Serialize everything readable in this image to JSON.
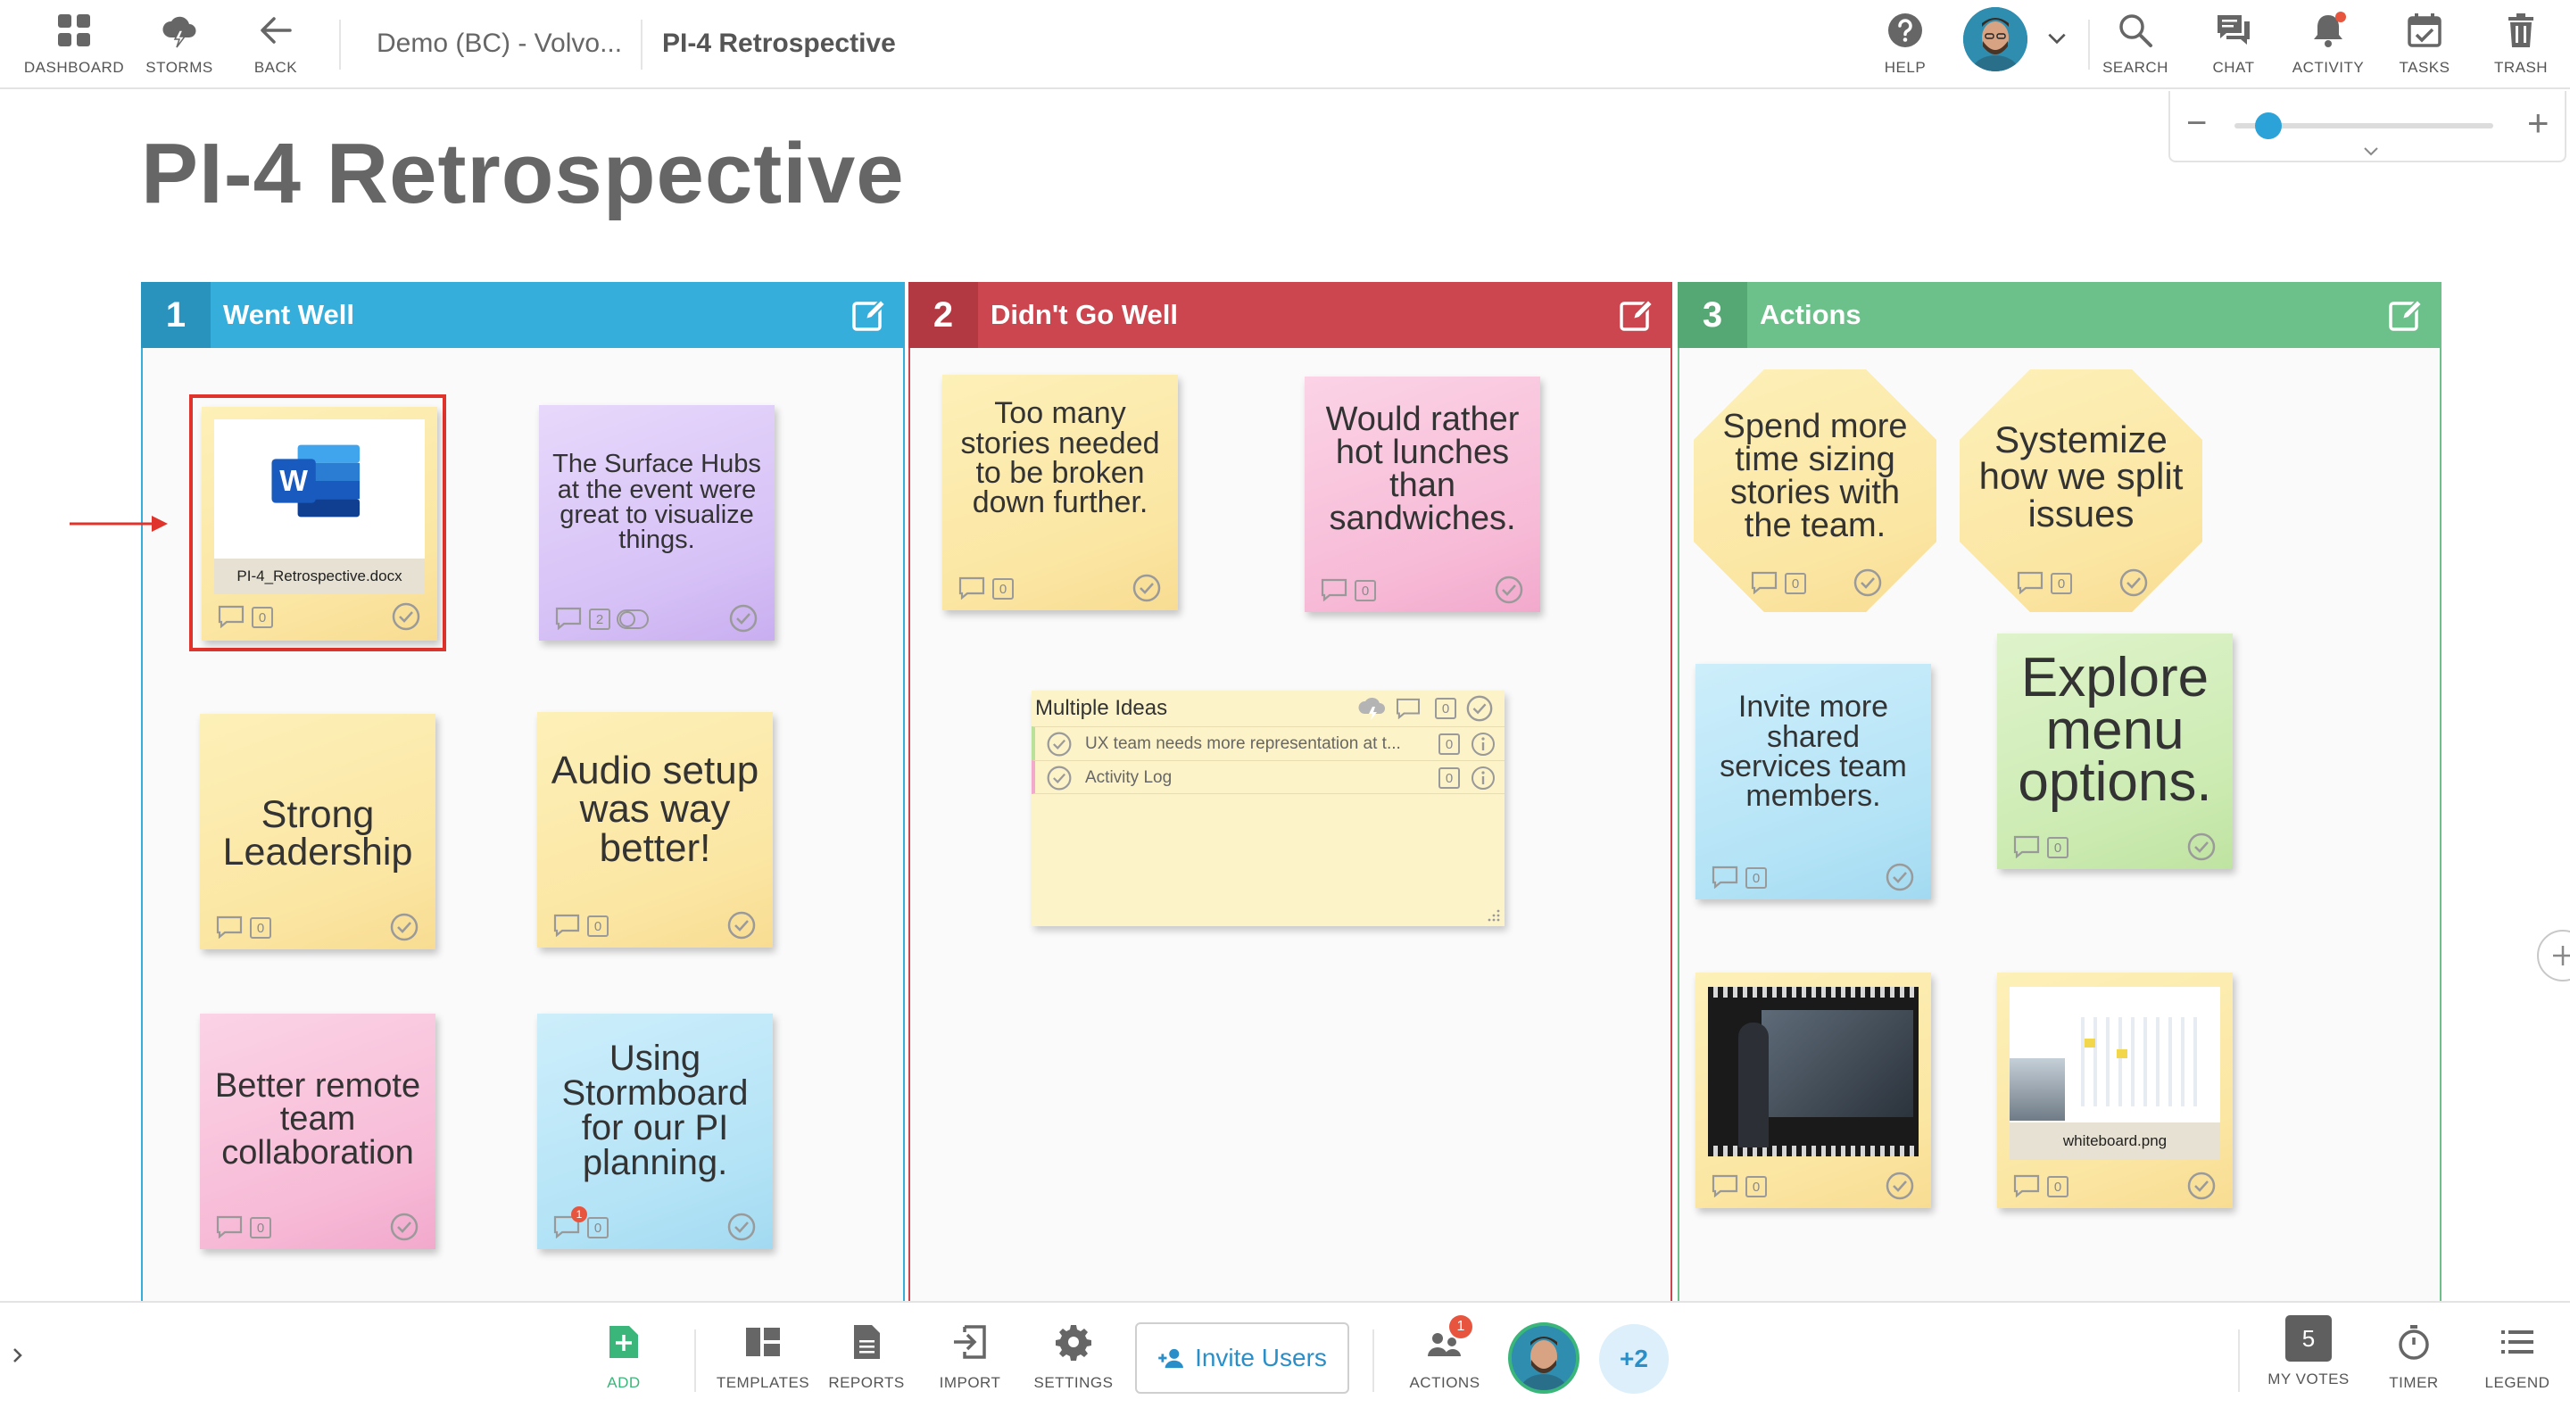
{
  "topbar": {
    "dashboard_label": "DASHBOARD",
    "storms_label": "STORMS",
    "back_label": "BACK",
    "breadcrumb_parent": "Demo (BC) - Volvo...",
    "breadcrumb_current": "PI-4 Retrospective",
    "help_label": "HELP",
    "search_label": "SEARCH",
    "chat_label": "CHAT",
    "activity_label": "ACTIVITY",
    "tasks_label": "TASKS",
    "trash_label": "TRASH"
  },
  "zoom": {
    "level": 0.13,
    "minus": "−",
    "plus": "+"
  },
  "board": {
    "title": "PI-4 Retrospective"
  },
  "columns": [
    {
      "number": "1",
      "title": "Went Well",
      "color": "#35aedc"
    },
    {
      "number": "2",
      "title": "Didn't Go Well",
      "color": "#cc4650"
    },
    {
      "number": "3",
      "title": "Actions",
      "color": "#6cc08a"
    }
  ],
  "notes": {
    "file_doc": {
      "filename": "PI-4_Retrospective.docx",
      "count": "0"
    },
    "surface_hubs": {
      "text": "The Surface Hubs at the event were great to visualize things.",
      "count": "2"
    },
    "strong_leadership": {
      "text": "Strong Leadership",
      "count": "0"
    },
    "audio_setup": {
      "text": "Audio setup was way better!",
      "count": "0"
    },
    "better_remote": {
      "text": "Better remote team collaboration",
      "count": "0"
    },
    "using_stormboard": {
      "text": "Using Stormboard for our PI planning.",
      "count": "0",
      "badge": "1"
    },
    "too_many_stories": {
      "text": "Too many stories needed to be broken down further.",
      "count": "0"
    },
    "hot_lunches": {
      "text": "Would rather hot lunches than sandwiches.",
      "count": "0"
    },
    "spend_more_time": {
      "text": "Spend more time sizing stories with the team.",
      "count": "0"
    },
    "systemize": {
      "text": "Systemize how we split issues",
      "count": "0"
    },
    "invite_more": {
      "text": "Invite more shared services team members.",
      "count": "0"
    },
    "explore_menu": {
      "text": "Explore menu options.",
      "count": "0"
    },
    "video_note": {
      "count": "0"
    },
    "whiteboard": {
      "filename": "whiteboard.png",
      "count": "0"
    }
  },
  "multiple_ideas": {
    "title": "Multiple Ideas",
    "count": "0",
    "items": [
      {
        "text": "UX team needs more representation at t...",
        "count": "0"
      },
      {
        "text": "Activity Log",
        "count": "0"
      }
    ]
  },
  "bottombar": {
    "add_label": "ADD",
    "templates_label": "TEMPLATES",
    "reports_label": "REPORTS",
    "import_label": "IMPORT",
    "settings_label": "SETTINGS",
    "invite_label": "Invite Users",
    "actions_label": "ACTIONS",
    "actions_badge": "1",
    "extra_users": "+2",
    "votes_count": "5",
    "my_votes_label": "MY VOTES",
    "timer_label": "TIMER",
    "legend_label": "LEGEND"
  },
  "colors": {
    "accent": "#2a8fc9",
    "add_green": "#3bb67a",
    "highlight_red": "#e0332b"
  }
}
